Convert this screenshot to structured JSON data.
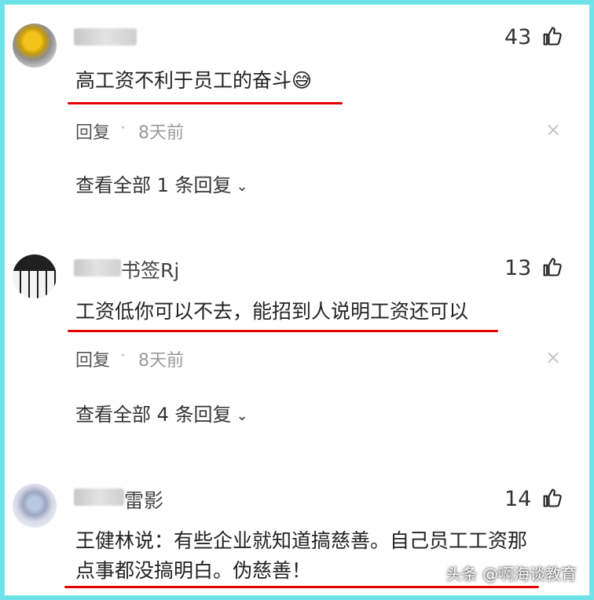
{
  "comments": [
    {
      "username": "",
      "likes": "43",
      "text": "高工资不利于员工的奋斗",
      "emoji": "😅",
      "reply_label": "回复",
      "time": "8天前",
      "view_all": "查看全部 1 条回复"
    },
    {
      "username": "书签Rj",
      "likes": "13",
      "text": "工资低你可以不去，能招到人说明工资还可以",
      "emoji": "",
      "reply_label": "回复",
      "time": "8天前",
      "view_all": "查看全部 4 条回复"
    },
    {
      "username": "雷影",
      "likes": "14",
      "text_line1": "王健林说：有些企业就知道搞慈善。自己员工工资那",
      "text_line2": "点事都没搞明白。伪慈善！"
    }
  ],
  "watermark": "头条 @啊海谈教育",
  "colors": {
    "frame_border": "#6fe3ea",
    "underline": "#e10000"
  },
  "icons": {
    "like": "thumbs-up-icon",
    "close": "close-icon",
    "chevron": "chevron-down-icon"
  }
}
